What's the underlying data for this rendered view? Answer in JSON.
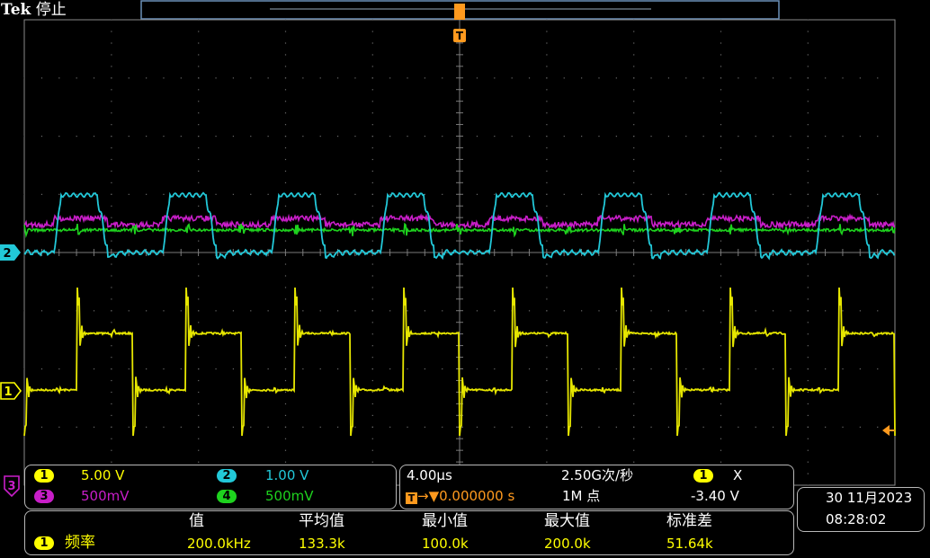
{
  "header": {
    "brand": "Tek",
    "run_state": "停止"
  },
  "markers": {
    "trigger": "T",
    "ch2": "2",
    "ch1": "1",
    "ch3": "3"
  },
  "channels": [
    {
      "num": "1",
      "scale": "5.00 V",
      "color": "#ffff00"
    },
    {
      "num": "2",
      "scale": "1.00 V",
      "color": "#22c8d8"
    },
    {
      "num": "3",
      "scale": "500mV",
      "color": "#c81ec8"
    },
    {
      "num": "4",
      "scale": "500mV",
      "color": "#1ed21e"
    }
  ],
  "timebase": {
    "scale": "4.00µs",
    "sample_rate": "2.50G次/秒",
    "trigger_pos": "0.000000 s",
    "record_length": "1M 点"
  },
  "trigger": {
    "source": "1",
    "slope": "X",
    "level": "-3.40 V"
  },
  "datetime": {
    "date": "30 11月2023",
    "time": "08:28:02"
  },
  "measurement": {
    "headers": [
      "值",
      "平均值",
      "最小值",
      "最大值",
      "标准差"
    ],
    "source": "1",
    "name": "频率",
    "values": [
      "200.0kHz",
      "133.3k",
      "100.0k",
      "200.0k",
      "51.64k"
    ]
  },
  "colors": {
    "accent_orange": "#ff9a1e",
    "grid": "#5a5a5a",
    "frame": "#9aa0a6"
  }
}
